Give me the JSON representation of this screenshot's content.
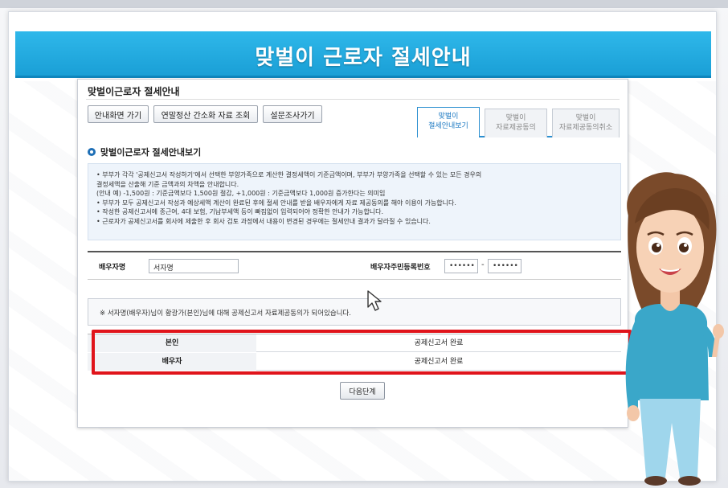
{
  "banner": {
    "title": "맞벌이 근로자 절세안내"
  },
  "window": {
    "title": "맞벌이근로자 절세안내",
    "buttons": {
      "home": "안내화면 가기",
      "lookup": "연말정산 간소화 자료 조회",
      "survey": "설문조사가기"
    },
    "tabs": [
      {
        "line1": "맞벌이",
        "line2": "절세안내보기"
      },
      {
        "line1": "맞벌이",
        "line2": "자료제공동의"
      },
      {
        "line1": "맞벌이",
        "line2": "자료제공동의취소"
      }
    ],
    "section_title": "맞벌이근로자 절세안내보기",
    "notice_lines": [
      "• 부부가 각각 '공제신고서 작성하기'에서 선택한 부양가족으로 계산한 결정세액이 기준금액이며, 부부가 부양가족을 선택할 수 있는 모든 경우의",
      "   결정세액을 산출해 기준 금액과의 차액을 안내합니다.",
      "   (안내 예) -1,500원 : 기준금액보다 1,500원 절감, +1,000원 : 기준금액보다 1,000원 증가한다는 의미임",
      "• 부부가 모두 공제신고서 작성과 예상세액 계산이 완료된 후에 절세 안내를 받을 배우자에게 자료 제공동의를 해야 이용이 가능합니다.",
      "• 작성한 공제신고서에 종근여, 4대 보험, 기납부세액 등이 빠짐없이 입력되어야 정확한 안내가 가능합니다.",
      "• 근로자가 공제신고서를 회사에 제출한 후 회사 검토 과정에서 내용이 변경된 경우에는 절세안내 결과가 달라질 수 있습니다."
    ],
    "form": {
      "spouse_name_label": "배우자명",
      "spouse_name_value": "서자명",
      "spouse_rrn_label": "배우자주민등록번호",
      "rrn_front": "••••••",
      "rrn_sep": "-",
      "rrn_back": "••••••"
    },
    "message": "※ 서자명(배우자)님이 황광가(본인)님에 대해 공제신고서 자료제공동의가 되어있습니다.",
    "status_rows": [
      {
        "label": "본인",
        "value": "공제신고서 완료"
      },
      {
        "label": "배우자",
        "value": "공제신고서 완료"
      }
    ],
    "next_button": "다음단계"
  },
  "colors": {
    "banner": "#1fa8df",
    "accent": "#1b78c2",
    "highlight": "#e0141b"
  },
  "icons": [
    "section-bullet-icon",
    "mouse-cursor-icon",
    "presenter-character"
  ]
}
